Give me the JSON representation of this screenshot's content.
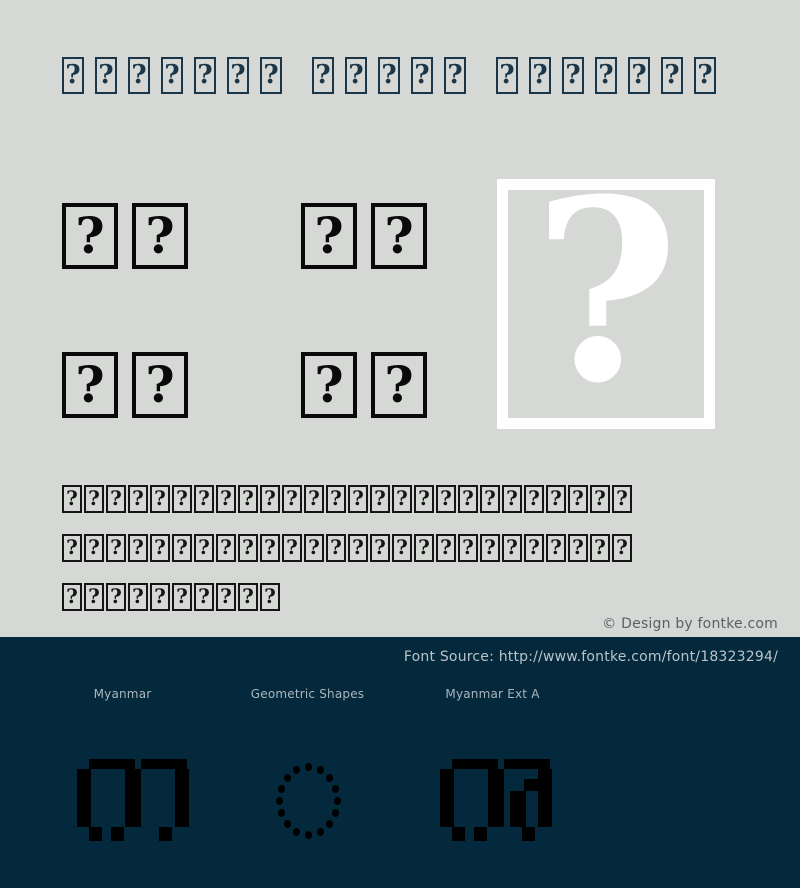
{
  "theme": {
    "background_light": "#d5d8d4",
    "background_dark": "#04283c",
    "tofu_stroke_title": "#1b3549",
    "tofu_stroke_dark": "#0a0a0a",
    "hero_stroke": "#ffffff",
    "credit_text_color": "#5b6163",
    "source_text_color": "#b9c4c9",
    "label_text_color": "#a9b6bc",
    "pixel_glyph_color": "#000000"
  },
  "title_row": {
    "glyph": "?",
    "groups": [
      7,
      5,
      7
    ]
  },
  "sample_quads": {
    "glyph": "?",
    "quads": [
      {
        "name": "top-left",
        "count": 2
      },
      {
        "name": "top-right",
        "count": 2
      },
      {
        "name": "bottom-left",
        "count": 2
      },
      {
        "name": "bottom-right",
        "count": 2
      }
    ]
  },
  "hero": {
    "glyph": "?"
  },
  "paragraph": {
    "glyph": "?",
    "line_counts": [
      26,
      26,
      10
    ]
  },
  "credit": {
    "text": "© Design by fontke.com"
  },
  "font_source": {
    "text": "Font Source: http://www.fontke.com/font/18323294/"
  },
  "unicode_blocks": [
    {
      "label": "Myanmar",
      "sample": "pixel-tofu-pair"
    },
    {
      "label": "Geometric Shapes",
      "sample": "dotted-circle"
    },
    {
      "label": "Myanmar Ext A",
      "sample": "pixel-tofu-pair-variant"
    }
  ]
}
